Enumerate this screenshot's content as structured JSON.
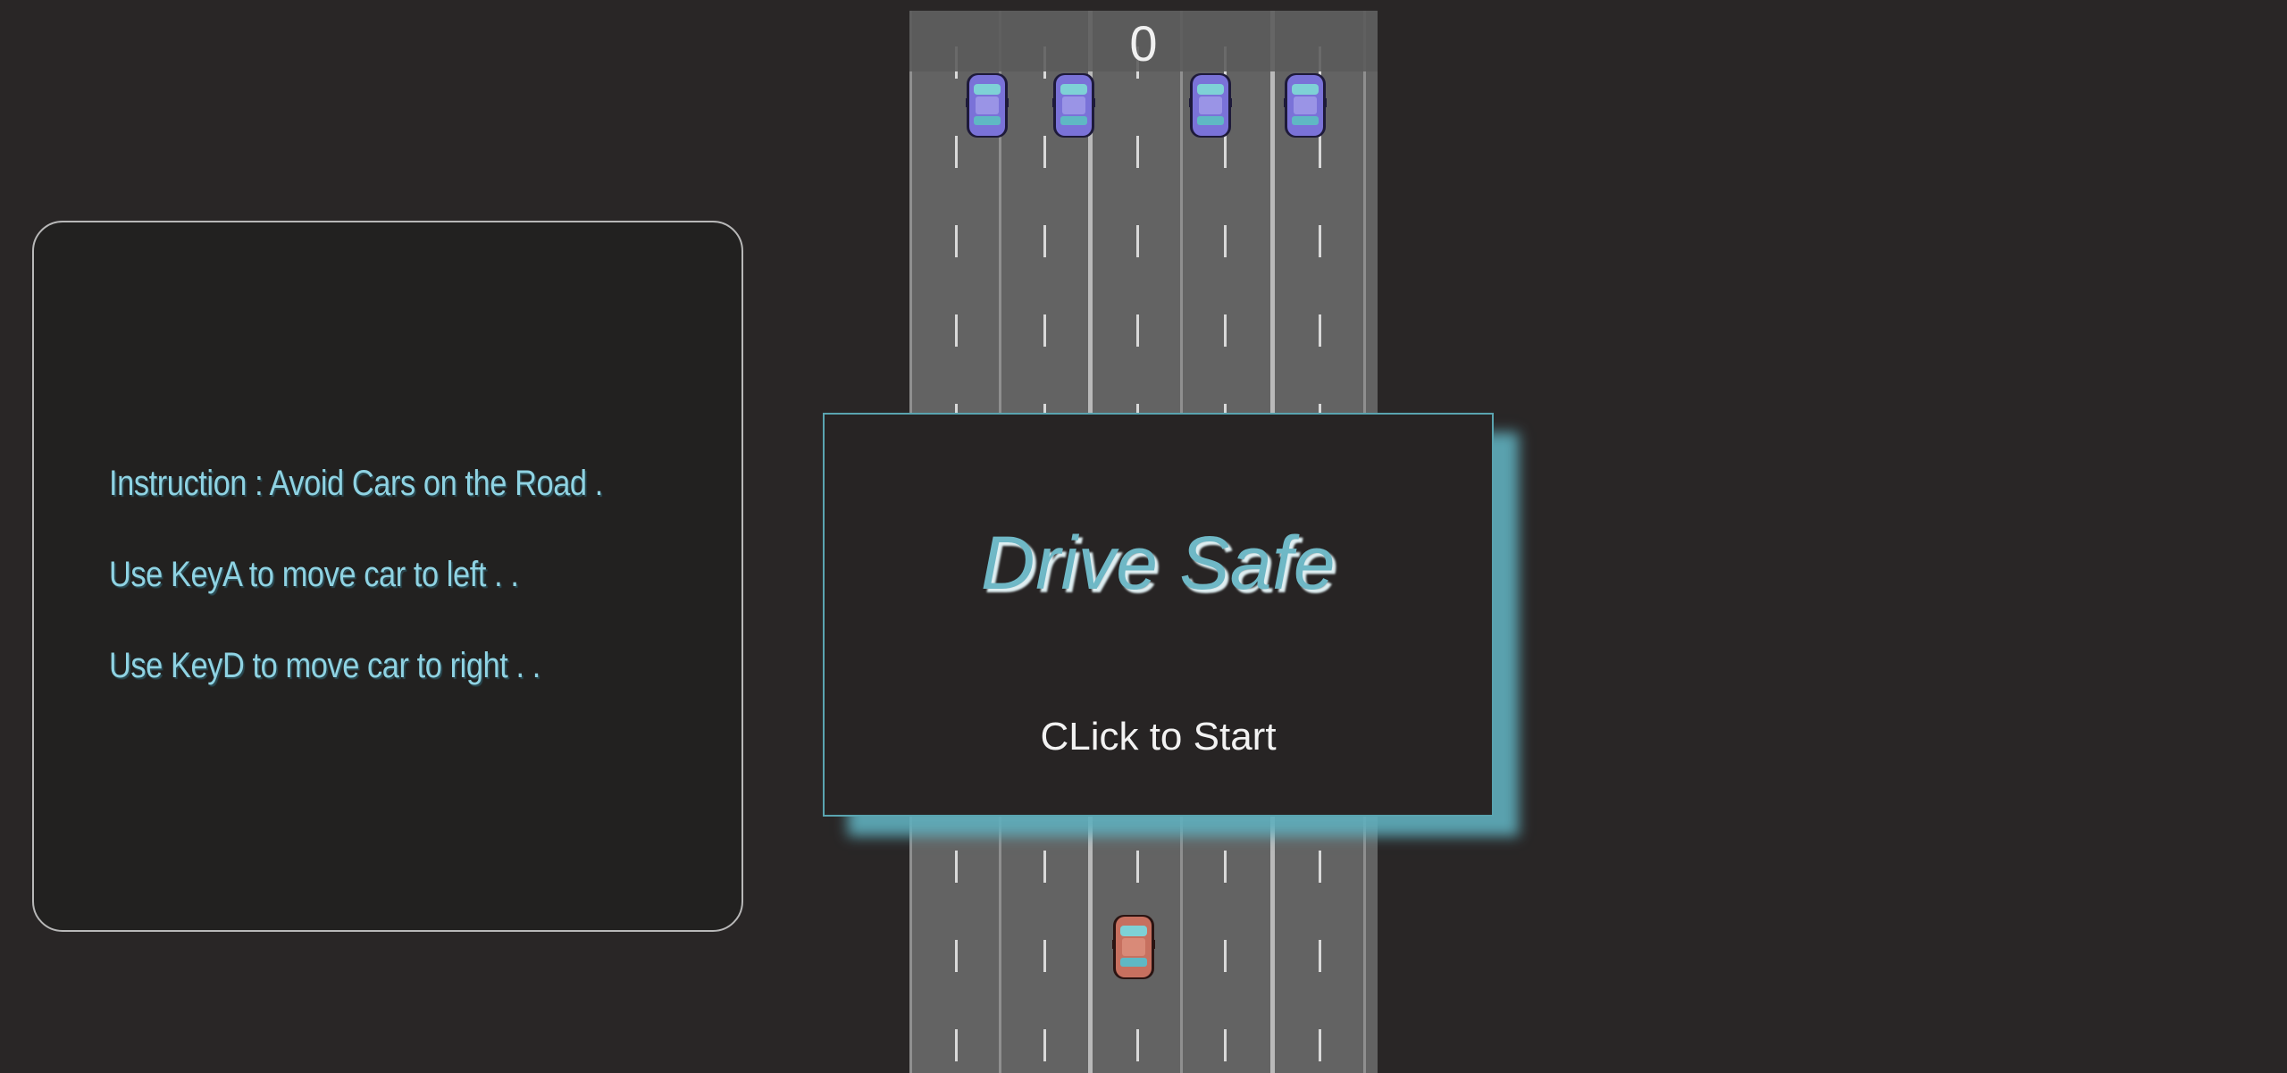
{
  "instructions": {
    "lines": [
      "Instruction : Avoid Cars on the Road .",
      "Use KeyA to move car to left . .",
      "Use KeyD to move car to right . ."
    ]
  },
  "score": {
    "value": "0"
  },
  "modal": {
    "title": "Drive Safe",
    "start_label": "CLick to Start"
  },
  "colors": {
    "background": "#292626",
    "road": "#636363",
    "accent": "#5aa4b0",
    "enemy_car": "#7a72d8",
    "player_car": "#c7705f"
  }
}
